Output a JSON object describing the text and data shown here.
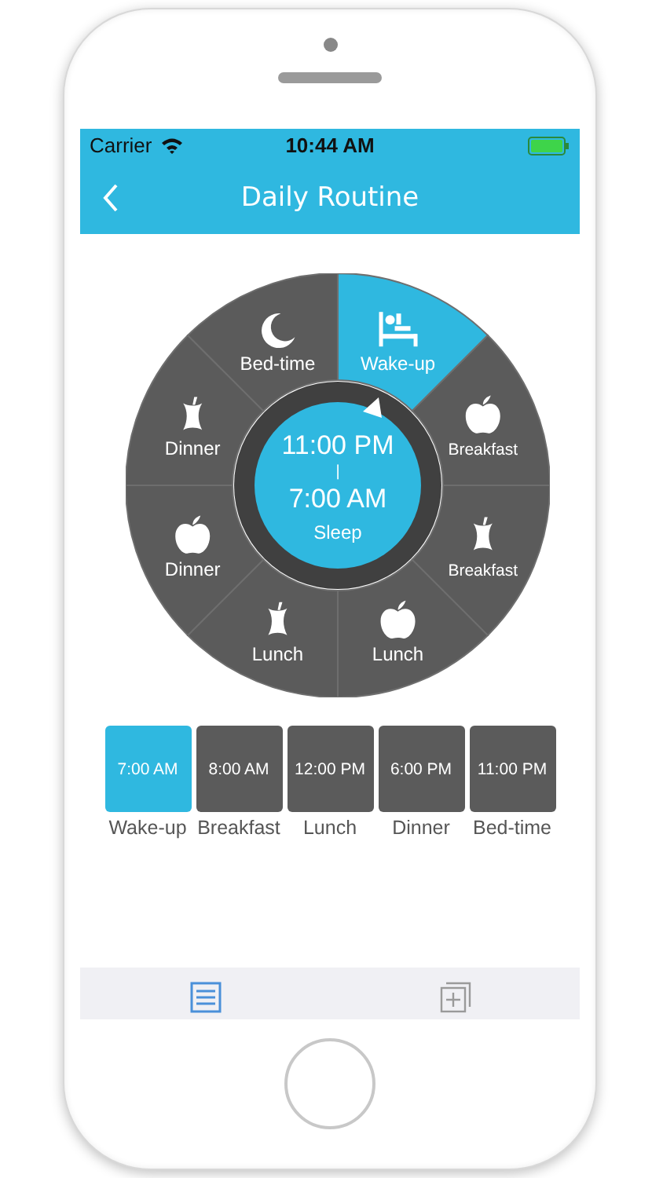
{
  "status_bar": {
    "carrier": "Carrier",
    "time": "10:44 AM"
  },
  "nav": {
    "title": "Daily Routine"
  },
  "wheel": {
    "segments": [
      {
        "label": "Wake-up",
        "kind": "bed",
        "selected": true
      },
      {
        "label": "Breakfast",
        "kind": "apple",
        "selected": false
      },
      {
        "label": "Breakfast",
        "kind": "core",
        "selected": false
      },
      {
        "label": "Lunch",
        "kind": "apple",
        "selected": false
      },
      {
        "label": "Lunch",
        "kind": "core",
        "selected": false
      },
      {
        "label": "Dinner",
        "kind": "apple",
        "selected": false
      },
      {
        "label": "Dinner",
        "kind": "core",
        "selected": false
      },
      {
        "label": "Bed-time",
        "kind": "moon",
        "selected": false
      }
    ],
    "center": {
      "start": "11:00 PM",
      "separator": "|",
      "end": "7:00 AM",
      "label": "Sleep"
    }
  },
  "schedule": [
    {
      "time": "7:00 AM",
      "label": "Wake-up",
      "selected": true
    },
    {
      "time": "8:00 AM",
      "label": "Breakfast",
      "selected": false
    },
    {
      "time": "12:00 PM",
      "label": "Lunch",
      "selected": false
    },
    {
      "time": "6:00 PM",
      "label": "Dinner",
      "selected": false
    },
    {
      "time": "11:00 PM",
      "label": "Bed-time",
      "selected": false
    }
  ],
  "tabs": [
    {
      "kind": "list",
      "selected": true
    },
    {
      "kind": "add",
      "selected": false
    }
  ]
}
